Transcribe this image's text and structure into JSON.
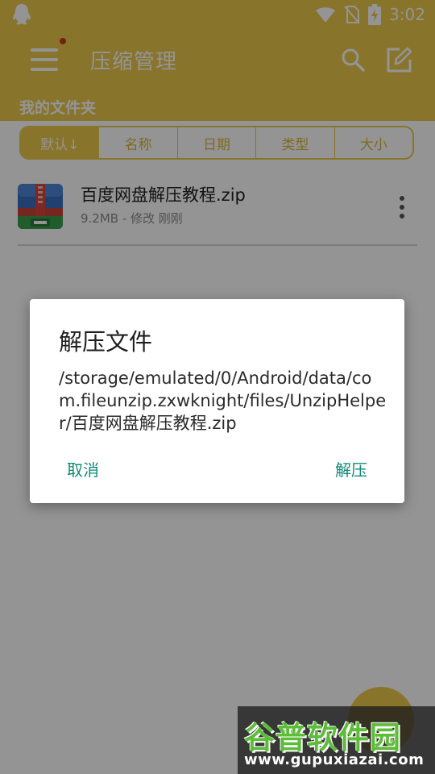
{
  "status_bar": {
    "time": "3:02"
  },
  "app_bar": {
    "title": "压缩管理"
  },
  "folder": {
    "title": "我的文件夹"
  },
  "sort": {
    "options": [
      "默认↓",
      "名称",
      "日期",
      "类型",
      "大小"
    ]
  },
  "file": {
    "name": "百度网盘解压教程.zip",
    "meta": "9.2MB - 修改 刚刚"
  },
  "dialog": {
    "title": "解压文件",
    "message": "/storage/emulated/0/Android/data/com.fileunzip.zxwknight/files/UnzipHelper/百度网盘解压教程.zip",
    "cancel_label": "取消",
    "confirm_label": "解压"
  },
  "watermark": {
    "title": "谷普软件园",
    "url": "www.gupuxiazai.com"
  },
  "colors": {
    "primary": "#EBC84A",
    "accent": "#0E8A77"
  },
  "icons": {
    "status_left": "qq-penguin-icon",
    "wifi": "wifi-icon",
    "sim": "no-sim-icon",
    "battery": "battery-charging-icon",
    "menu": "hamburger-menu-icon",
    "search": "search-icon",
    "edit": "edit-icon",
    "file": "zip-archive-icon",
    "more": "more-vertical-icon"
  }
}
